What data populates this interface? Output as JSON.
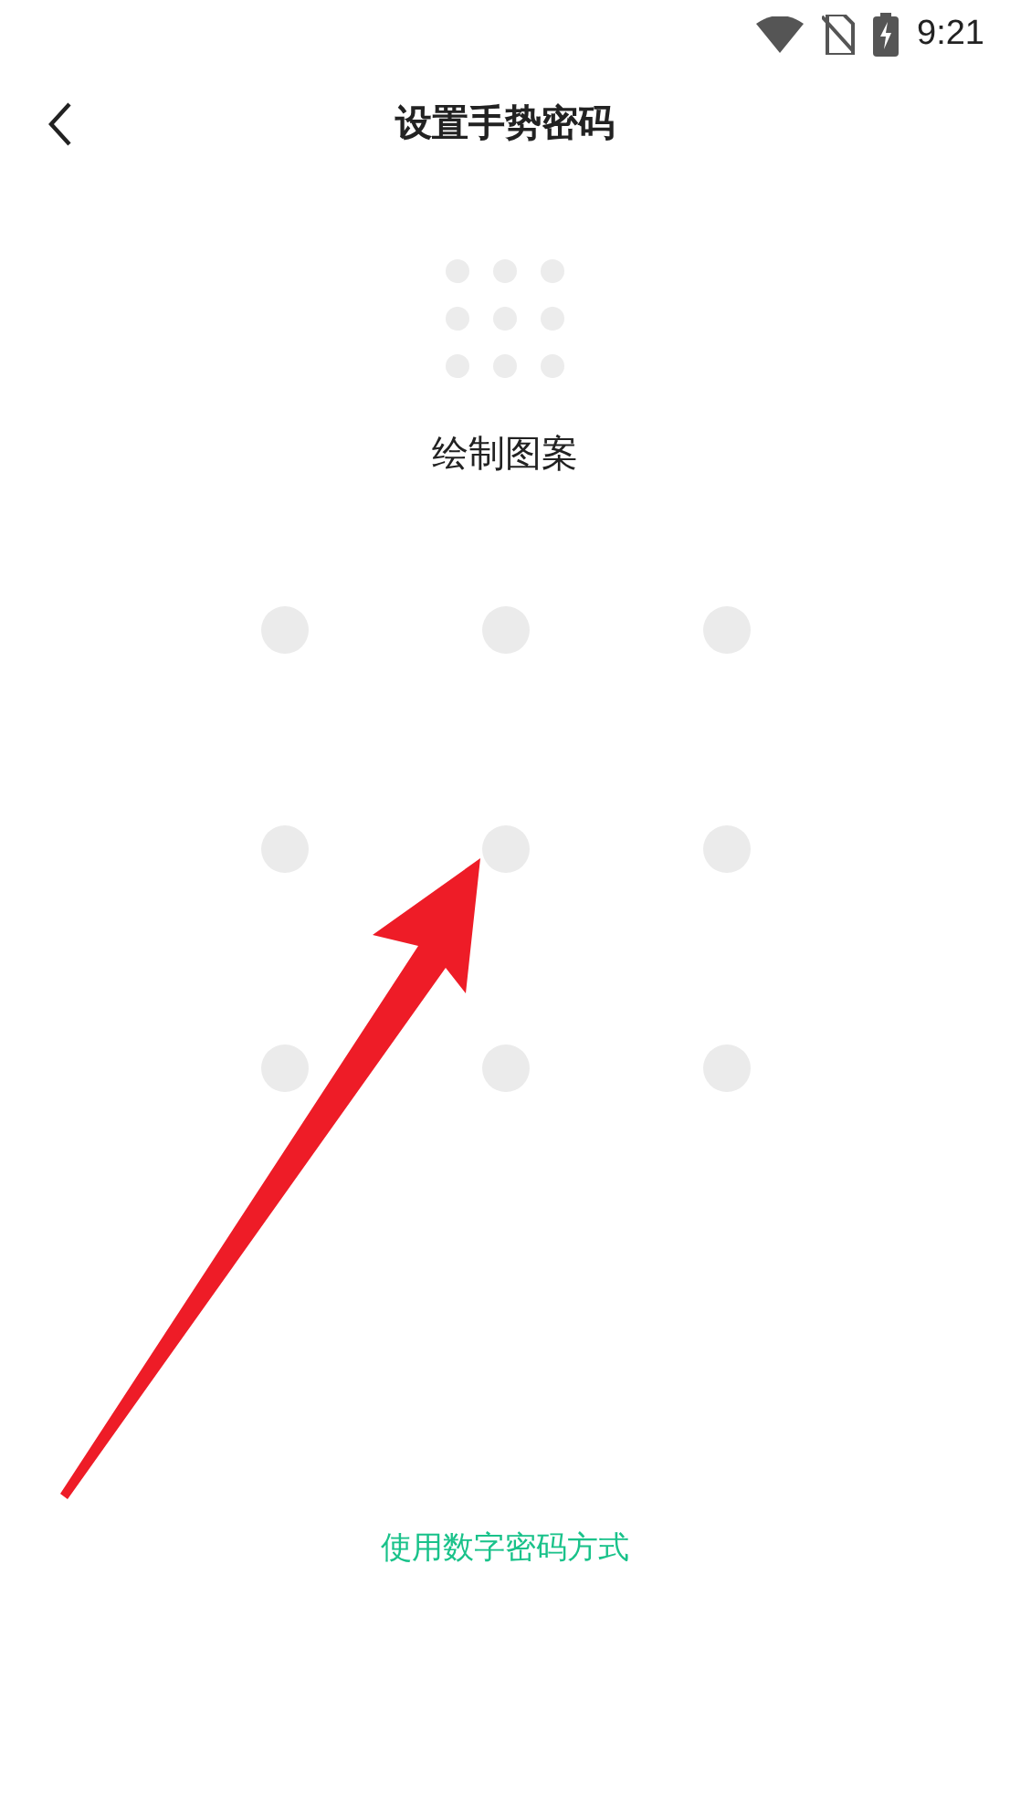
{
  "status_bar": {
    "time": "9:21"
  },
  "header": {
    "title": "设置手势密码"
  },
  "prompt": "绘制图案",
  "alternate_link": "使用数字密码方式"
}
